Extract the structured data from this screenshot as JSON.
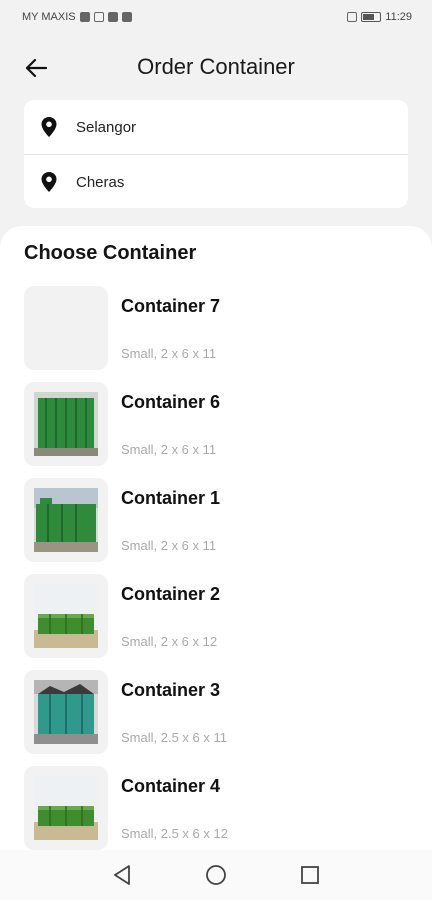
{
  "status_bar": {
    "carrier": "MY MAXIS",
    "time": "11:29"
  },
  "header": {
    "title": "Order Container",
    "back_icon": "arrow-left-icon"
  },
  "location": {
    "state": "Selangor",
    "area": "Cheras",
    "icon": "map-pin-icon"
  },
  "section_title": "Choose Container",
  "containers": [
    {
      "name": "Container 7",
      "spec": "Small, 2 x 6 x 11"
    },
    {
      "name": "Container 6",
      "spec": "Small, 2 x 6 x 11"
    },
    {
      "name": "Container 1",
      "spec": "Small, 2 x 6 x 11"
    },
    {
      "name": "Container 2",
      "spec": "Small, 2 x 6 x 12"
    },
    {
      "name": "Container 3",
      "spec": "Small, 2.5 x 6 x 11"
    },
    {
      "name": "Container 4",
      "spec": "Small, 2.5 x 6 x 12"
    }
  ],
  "nav": {
    "back": "triangle-back-icon",
    "home": "circle-home-icon",
    "recents": "square-recents-icon"
  },
  "colors": {
    "container_green": "#2e8b3e",
    "background": "#f2f2f2"
  }
}
